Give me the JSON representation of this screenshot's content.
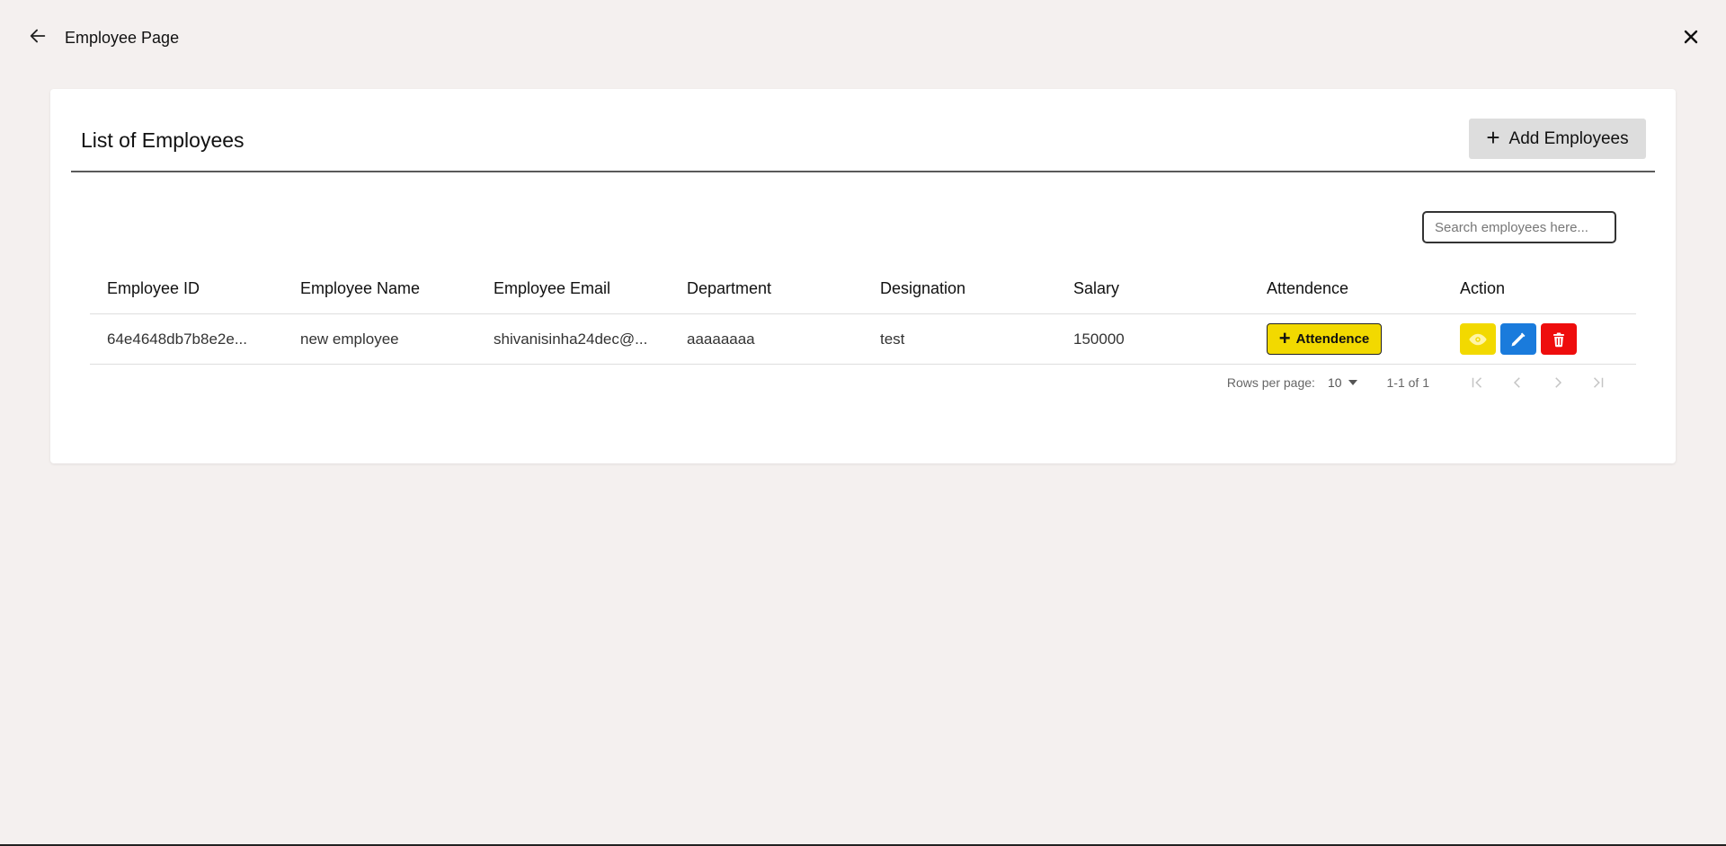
{
  "header": {
    "title": "Employee Page"
  },
  "card": {
    "title": "List of Employees",
    "add_button_label": "Add Employees"
  },
  "search": {
    "placeholder": "Search employees here..."
  },
  "table": {
    "columns": [
      "Employee ID",
      "Employee Name",
      "Employee Email",
      "Department",
      "Designation",
      "Salary",
      "Attendence",
      "Action"
    ],
    "rows": [
      {
        "id": "64e4648db7b8e2e...",
        "name": "new employee",
        "email": "shivanisinha24dec@...",
        "department": "aaaaaaaa",
        "designation": "test",
        "salary": "150000",
        "attendence_button": "Attendence"
      }
    ]
  },
  "pagination": {
    "rows_per_page_label": "Rows per page:",
    "rows_per_page_value": "10",
    "range": "1-1 of 1"
  },
  "colors": {
    "background": "#f4f0ef",
    "attendence_yellow": "#f2d900",
    "edit_blue": "#1a7bdc",
    "delete_red": "#ee0d0d"
  },
  "icons": {
    "back": "arrow-left-icon",
    "close": "close-icon",
    "add": "plus-icon",
    "view": "eye-icon",
    "edit": "pencil-icon",
    "delete": "trash-icon",
    "first": "first-page-icon",
    "prev": "chevron-left-icon",
    "next": "chevron-right-icon",
    "last": "last-page-icon"
  }
}
